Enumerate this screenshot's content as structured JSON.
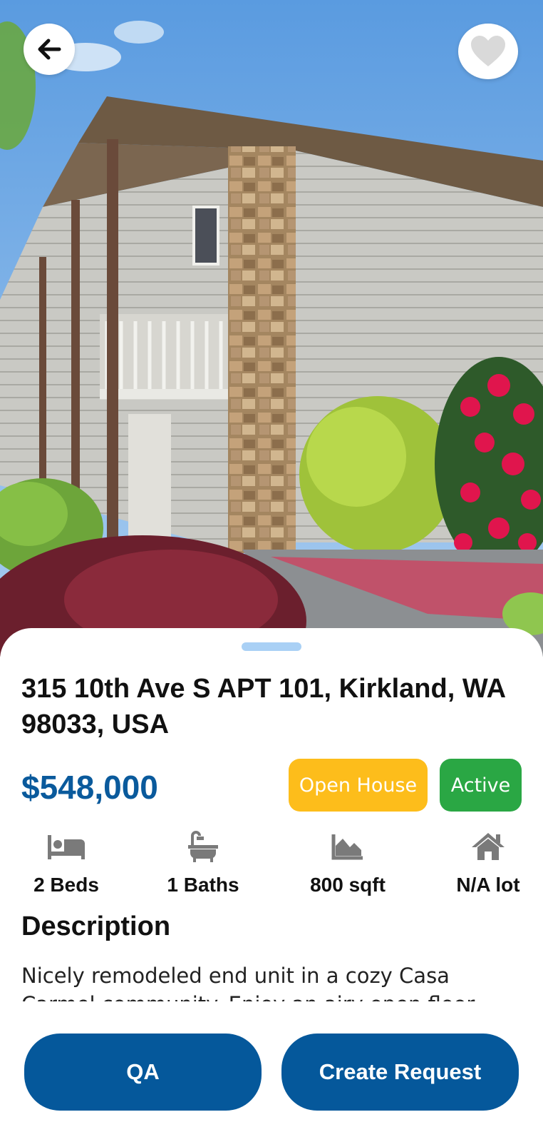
{
  "listing": {
    "address": "315 10th Ave S APT 101, Kirkland, WA 98033, USA",
    "price": "$548,000",
    "badges": {
      "open_house": "Open House",
      "status": "Active"
    },
    "stats": {
      "beds": "2 Beds",
      "baths": "1 Baths",
      "sqft": "800 sqft",
      "lot": "N/A lot"
    },
    "description_title": "Description",
    "description": "Nicely remodeled end unit in a cozy Casa Carmel community. Enjoy an airy open floor"
  },
  "actions": {
    "qa_label": "QA",
    "create_request_label": "Create Request"
  },
  "icons": {
    "back": "arrow-left-icon",
    "favorite": "heart-icon",
    "beds": "bed-icon",
    "baths": "bathtub-icon",
    "sqft": "area-chart-icon",
    "lot": "house-icon"
  },
  "colors": {
    "primary": "#05589b",
    "price": "#0a5a9c",
    "open_house": "#fdbd1b",
    "active": "#2aa744",
    "handle": "#a9d0f5",
    "icon_gray": "#7a7a7a"
  }
}
